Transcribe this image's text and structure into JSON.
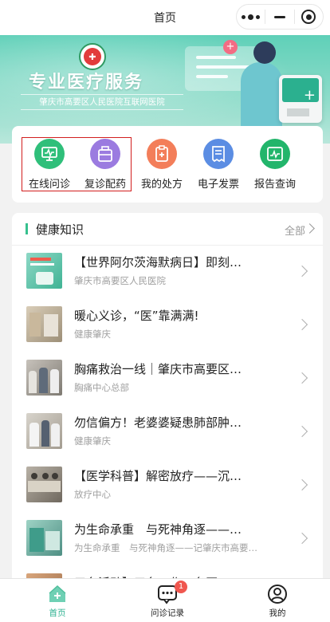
{
  "navbar": {
    "title": "首页"
  },
  "banner": {
    "title": "专业医疗服务",
    "subtitle": "肇庆市高要区人民医院互联网医院"
  },
  "quick_entries": [
    {
      "label": "在线问诊",
      "icon": "monitor-pulse-icon",
      "color": "#2fbf7a"
    },
    {
      "label": "复诊配药",
      "icon": "medicine-box-icon",
      "color": "#9b7be0"
    },
    {
      "label": "我的处方",
      "icon": "prescription-clipboard-icon",
      "color": "#f37e5a"
    },
    {
      "label": "电子发票",
      "icon": "invoice-icon",
      "color": "#5b8de3"
    },
    {
      "label": "报告查询",
      "icon": "report-icon",
      "color": "#22b56b"
    }
  ],
  "health": {
    "title": "健康知识",
    "all_label": "全部",
    "articles": [
      {
        "title": "【世界阿尔茨海默病日】即刻…",
        "source": "肇庆市高要区人民医院"
      },
      {
        "title": "暖心义诊，“医”靠满满!",
        "source": "健康肇庆"
      },
      {
        "title": "胸痛救治一线｜肇庆市高要区…",
        "source": "胸痛中心总部"
      },
      {
        "title": "勿信偏方！老婆婆疑患肺部肿…",
        "source": "健康肇庆"
      },
      {
        "title": "【医学科普】解密放疗——沉…",
        "source": "放疗中心"
      },
      {
        "title": "为生命承重　与死神角逐——…",
        "source": "为生命承重　与死神角逐——记肇庆市高要…"
      },
      {
        "title": "三名活动】三名工作　名医工",
        "source": ""
      }
    ]
  },
  "tabbar": {
    "items": [
      {
        "label": "首页",
        "icon": "home-icon"
      },
      {
        "label": "问诊记录",
        "icon": "chat-bubble-icon",
        "badge": "1"
      },
      {
        "label": "我的",
        "icon": "user-icon"
      }
    ]
  }
}
